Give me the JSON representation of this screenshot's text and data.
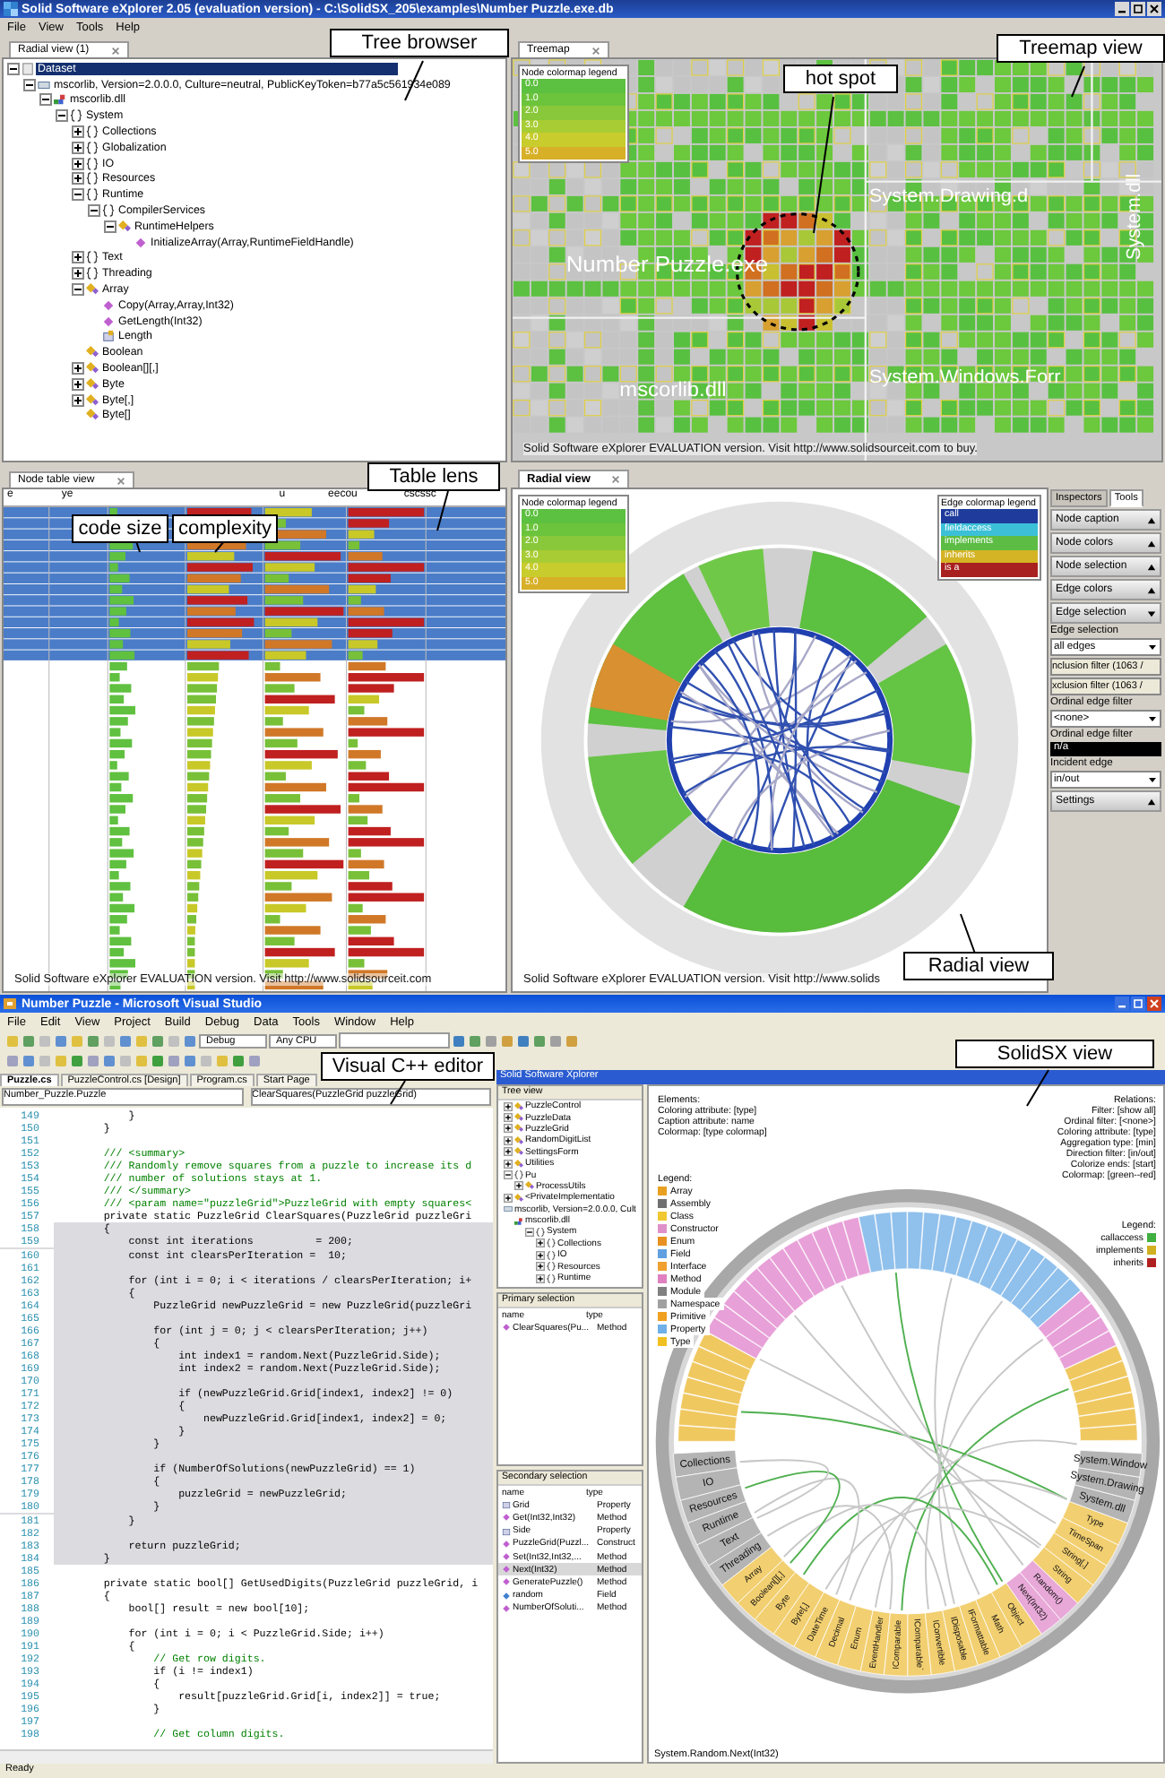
{
  "app_window": {
    "title": "Solid Software eXplorer 2.05 (evaluation version) - C:\\SolidSX_205\\examples\\Number Puzzle.exe.db",
    "menu": [
      "File",
      "View",
      "Tools",
      "Help"
    ]
  },
  "tree_browser": {
    "tab": "Radial view (1)",
    "items": [
      {
        "label": "Dataset",
        "kind": "dataset",
        "expanded": true,
        "selected": true,
        "children": [
          {
            "label": "mscorlib, Version=2.0.0.0, Culture=neutral, PublicKeyToken=b77a5c561934e089",
            "kind": "assembly",
            "expanded": true,
            "selected": false,
            "children": [
              {
                "label": "mscorlib.dll",
                "kind": "module",
                "expanded": true,
                "selected": false,
                "children": [
                  {
                    "label": "System",
                    "kind": "namespace",
                    "expanded": true,
                    "selected": false,
                    "children": [
                      {
                        "label": "Collections",
                        "kind": "namespace",
                        "expanded": false,
                        "selected": false
                      },
                      {
                        "label": "Globalization",
                        "kind": "namespace",
                        "expanded": false,
                        "selected": false
                      },
                      {
                        "label": "IO",
                        "kind": "namespace",
                        "expanded": false,
                        "selected": false
                      },
                      {
                        "label": "Resources",
                        "kind": "namespace",
                        "expanded": false,
                        "selected": false
                      },
                      {
                        "label": "Runtime",
                        "kind": "namespace",
                        "expanded": true,
                        "selected": false,
                        "children": [
                          {
                            "label": "CompilerServices",
                            "kind": "namespace",
                            "expanded": true,
                            "selected": false,
                            "children": [
                              {
                                "label": "RuntimeHelpers",
                                "kind": "class",
                                "expanded": true,
                                "selected": false,
                                "children": [
                                  {
                                    "label": "InitializeArray(Array,RuntimeFieldHandle)",
                                    "kind": "method",
                                    "selected": false
                                  }
                                ]
                              }
                            ]
                          }
                        ]
                      },
                      {
                        "label": "Text",
                        "kind": "namespace",
                        "expanded": false,
                        "selected": false
                      },
                      {
                        "label": "Threading",
                        "kind": "namespace",
                        "expanded": false,
                        "selected": false
                      },
                      {
                        "label": "Array",
                        "kind": "class",
                        "expanded": true,
                        "selected": false,
                        "children": [
                          {
                            "label": "Copy(Array,Array,Int32)",
                            "kind": "method",
                            "selected": false
                          },
                          {
                            "label": "GetLength(Int32)",
                            "kind": "method",
                            "selected": false
                          },
                          {
                            "label": "Length",
                            "kind": "property",
                            "selected": false
                          }
                        ]
                      },
                      {
                        "label": "Boolean",
                        "kind": "class",
                        "selected": false
                      },
                      {
                        "label": "Boolean[][,]",
                        "kind": "class",
                        "expanded": false,
                        "selected": false
                      },
                      {
                        "label": "Byte",
                        "kind": "class",
                        "expanded": false,
                        "selected": false
                      },
                      {
                        "label": "Byte[,]",
                        "kind": "class",
                        "expanded": false,
                        "selected": false
                      },
                      {
                        "label": "Byte[]",
                        "kind": "class",
                        "selected": false
                      }
                    ]
                  }
                ]
              }
            ]
          }
        ]
      }
    ]
  },
  "treemap": {
    "tab": "Treemap",
    "legend_title": "Node colormap legend",
    "legend": [
      {
        "label": "0.0",
        "color": "#5cc040"
      },
      {
        "label": "1.0",
        "color": "#6cc43c"
      },
      {
        "label": "2.0",
        "color": "#88c83a"
      },
      {
        "label": "3.0",
        "color": "#a8cc34"
      },
      {
        "label": "4.0",
        "color": "#c8cc2c"
      },
      {
        "label": "5.0",
        "color": "#d8b028"
      }
    ],
    "regions": [
      "Number Puzzle.exe",
      "System.Drawing.d",
      "System.dll",
      "System.Windows.Forr",
      "mscorlib.dll"
    ],
    "notice": "Solid Software eXplorer EVALUATION version. Visit http://www.solidsourceit.com to buy."
  },
  "table_view": {
    "tab": "Node table view",
    "headers": [
      "e",
      "ye",
      "u",
      "eecou",
      "cscssc"
    ],
    "notice": "Solid Software eXplorer EVALUATION version. Visit http://www.solidsourceit.com"
  },
  "radial_view": {
    "tab": "Radial view",
    "node_legend_title": "Node colormap legend",
    "node_legend": [
      {
        "label": "0.0",
        "color": "#5cc040"
      },
      {
        "label": "1.0",
        "color": "#6cc43c"
      },
      {
        "label": "2.0",
        "color": "#88c83a"
      },
      {
        "label": "3.0",
        "color": "#a8cc34"
      },
      {
        "label": "4.0",
        "color": "#c8cc2c"
      },
      {
        "label": "5.0",
        "color": "#d8b028"
      }
    ],
    "edge_legend_title": "Edge colormap legend",
    "edge_legend": [
      {
        "label": "call",
        "color": "#1f3c9c"
      },
      {
        "label": "fieldaccess",
        "color": "#3cc0d8"
      },
      {
        "label": "implements",
        "color": "#5cbc44"
      },
      {
        "label": "inherits",
        "color": "#d4b424"
      },
      {
        "label": "is a",
        "color": "#a82020"
      }
    ],
    "notice": "Solid Software eXplorer EVALUATION version. Visit http://www.solids"
  },
  "tools_panel": {
    "tabs": [
      {
        "label": "Inspectors",
        "selected": false
      },
      {
        "label": "Tools",
        "selected": true
      }
    ],
    "controls": [
      {
        "kind": "section",
        "label": "Node caption",
        "expanded": false
      },
      {
        "kind": "section",
        "label": "Node colors",
        "expanded": false
      },
      {
        "kind": "section",
        "label": "Node selection",
        "expanded": false
      },
      {
        "kind": "section",
        "label": "Edge colors",
        "expanded": false
      },
      {
        "kind": "section",
        "label": "Edge selection",
        "expanded": true
      },
      {
        "kind": "label",
        "label": "Edge selection"
      },
      {
        "kind": "dropdown",
        "label": "all edges"
      },
      {
        "kind": "button",
        "label": "nclusion filter (1063 /"
      },
      {
        "kind": "button",
        "label": "xclusion filter (1063 /"
      },
      {
        "kind": "label",
        "label": "Ordinal edge filter"
      },
      {
        "kind": "dropdown",
        "label": "<none>"
      },
      {
        "kind": "label",
        "label": "Ordinal edge filter"
      },
      {
        "kind": "dark_field",
        "label": "n/a"
      },
      {
        "kind": "label",
        "label": "Incident edge"
      },
      {
        "kind": "dropdown",
        "label": "in/out"
      },
      {
        "kind": "section",
        "label": "Settings",
        "expanded": false
      }
    ]
  },
  "vs_window": {
    "title": "Number Puzzle - Microsoft Visual Studio",
    "menu": [
      "File",
      "Edit",
      "View",
      "Project",
      "Build",
      "Debug",
      "Data",
      "Tools",
      "Window",
      "Help"
    ],
    "toolbar_fields": [
      "Debug",
      "Any CPU"
    ],
    "tabs": [
      {
        "label": "Puzzle.cs",
        "selected": true
      },
      {
        "label": "PuzzleControl.cs [Design]",
        "selected": false
      },
      {
        "label": "Program.cs",
        "selected": false
      },
      {
        "label": "Start Page",
        "selected": false
      }
    ],
    "class_dropdown": "Number_Puzzle.Puzzle",
    "member_dropdown": "ClearSquares(PuzzleGrid puzzleGrid)",
    "code_lines": [
      {
        "number": "149",
        "text": "            }",
        "kind": "code",
        "highlighted": false
      },
      {
        "number": "150",
        "text": "        }",
        "kind": "code",
        "highlighted": false
      },
      {
        "number": "151",
        "highlighted": false
      },
      {
        "number": "152",
        "text": "        /// <summary>",
        "kind": "comment",
        "highlighted": false
      },
      {
        "number": "153",
        "text": "        /// Randomly remove squares from a puzzle to increase its d",
        "kind": "comment",
        "highlighted": false
      },
      {
        "number": "154",
        "text": "        /// number of solutions stays at 1.",
        "kind": "comment",
        "highlighted": false
      },
      {
        "number": "155",
        "text": "        /// </summary>",
        "kind": "comment",
        "highlighted": false
      },
      {
        "number": "156",
        "text": "        /// <param name=\"puzzleGrid\">PuzzleGrid with empty squares<",
        "kind": "comment",
        "highlighted": false
      },
      {
        "number": "157",
        "text": "        private static PuzzleGrid ClearSquares(PuzzleGrid puzzleGri",
        "kind": "code",
        "highlighted": false
      },
      {
        "number": "158",
        "text": "        {",
        "kind": "code",
        "highlighted": true
      },
      {
        "number": "159",
        "text": "            const int iterations          = 200;",
        "kind": "code",
        "highlighted": true
      },
      {
        "number": "160",
        "text": "            const int clearsPerIteration =  10;",
        "kind": "code",
        "highlighted": true
      },
      {
        "number": "161",
        "highlighted": true
      },
      {
        "number": "162",
        "text": "            for (int i = 0; i < iterations / clearsPerIteration; i+",
        "kind": "code",
        "highlighted": true
      },
      {
        "number": "163",
        "text": "            {",
        "kind": "code",
        "highlighted": true
      },
      {
        "number": "164",
        "text": "                PuzzleGrid newPuzzleGrid = new PuzzleGrid(puzzleGri",
        "kind": "code",
        "highlighted": true
      },
      {
        "number": "165",
        "highlighted": true
      },
      {
        "number": "166",
        "text": "                for (int j = 0; j < clearsPerIteration; j++)",
        "kind": "code",
        "highlighted": true
      },
      {
        "number": "167",
        "text": "                {",
        "kind": "code",
        "highlighted": true
      },
      {
        "number": "168",
        "text": "                    int index1 = random.Next(PuzzleGrid.Side);",
        "kind": "code",
        "highlighted": true
      },
      {
        "number": "169",
        "text": "                    int index2 = random.Next(PuzzleGrid.Side);",
        "kind": "code",
        "highlighted": true
      },
      {
        "number": "170",
        "highlighted": true
      },
      {
        "number": "171",
        "text": "                    if (newPuzzleGrid.Grid[index1, index2] != 0)",
        "kind": "code",
        "highlighted": true
      },
      {
        "number": "172",
        "text": "                    {",
        "kind": "code",
        "highlighted": true
      },
      {
        "number": "173",
        "text": "                        newPuzzleGrid.Grid[index1, index2] = 0;",
        "kind": "code",
        "highlighted": true
      },
      {
        "number": "174",
        "text": "                    }",
        "kind": "code",
        "highlighted": true
      },
      {
        "number": "175",
        "text": "                }",
        "kind": "code",
        "highlighted": true
      },
      {
        "number": "176",
        "highlighted": true
      },
      {
        "number": "177",
        "text": "                if (NumberOfSolutions(newPuzzleGrid) == 1)",
        "kind": "code",
        "highlighted": true
      },
      {
        "number": "178",
        "text": "                {",
        "kind": "code",
        "highlighted": true
      },
      {
        "number": "179",
        "text": "                    puzzleGrid = newPuzzleGrid;",
        "kind": "code",
        "highlighted": true
      },
      {
        "number": "180",
        "text": "                }",
        "kind": "code",
        "highlighted": true
      },
      {
        "number": "181",
        "text": "            }",
        "kind": "code",
        "highlighted": true
      },
      {
        "number": "182",
        "highlighted": true
      },
      {
        "number": "183",
        "text": "            return puzzleGrid;",
        "kind": "code",
        "highlighted": true
      },
      {
        "number": "184",
        "text": "        }",
        "kind": "code",
        "highlighted": true
      },
      {
        "number": "185",
        "highlighted": false
      },
      {
        "number": "186",
        "text": "        private static bool[] GetUsedDigits(PuzzleGrid puzzleGrid, i",
        "kind": "code",
        "highlighted": false
      },
      {
        "number": "187",
        "text": "        {",
        "kind": "code",
        "highlighted": false
      },
      {
        "number": "188",
        "text": "            bool[] result = new bool[10];",
        "kind": "code",
        "highlighted": false
      },
      {
        "number": "189",
        "highlighted": false
      },
      {
        "number": "190",
        "text": "            for (int i = 0; i < PuzzleGrid.Side; i++)",
        "kind": "code",
        "highlighted": false
      },
      {
        "number": "191",
        "text": "            {",
        "kind": "code",
        "highlighted": false
      },
      {
        "number": "192",
        "text": "                // Get row digits.",
        "kind": "comment",
        "highlighted": false
      },
      {
        "number": "193",
        "text": "                if (i != index1)",
        "kind": "code",
        "highlighted": false
      },
      {
        "number": "194",
        "text": "                {",
        "kind": "code",
        "highlighted": false
      },
      {
        "number": "195",
        "text": "                    result[puzzleGrid.Grid[i, index2]] = true;",
        "kind": "code",
        "highlighted": false
      },
      {
        "number": "196",
        "text": "                }",
        "kind": "code",
        "highlighted": false
      },
      {
        "number": "197",
        "highlighted": false
      },
      {
        "number": "198",
        "text": "                // Get column digits.",
        "kind": "comment",
        "highlighted": false
      }
    ],
    "status": "Ready"
  },
  "sx_panel": {
    "title": "Solid Software Xplorer",
    "tree_title": "Tree view",
    "tree_items": [
      {
        "label": "PuzzleControl",
        "kind": "class",
        "expanded": false
      },
      {
        "label": "PuzzleData",
        "kind": "class",
        "expanded": false
      },
      {
        "label": "PuzzleGrid",
        "kind": "class",
        "expanded": false
      },
      {
        "label": "RandomDigitList",
        "kind": "class",
        "expanded": false
      },
      {
        "label": "SettingsForm",
        "kind": "class",
        "expanded": false
      },
      {
        "label": "Utilities",
        "kind": "class",
        "expanded": false
      },
      {
        "label": "Pu",
        "kind": "namespace",
        "expanded": true,
        "children": [
          {
            "label": "ProcessUtils",
            "kind": "class",
            "expanded": false
          }
        ]
      },
      {
        "label": "<PrivateImplementatio",
        "kind": "class",
        "expanded": false
      },
      {
        "label": "mscorlib, Version=2.0.0.0, Cult",
        "kind": "assembly",
        "children": [
          {
            "label": "mscorlib.dll",
            "kind": "module",
            "children": [
              {
                "label": "System",
                "kind": "namespace",
                "expanded": true,
                "children": [
                  {
                    "label": "Collections",
                    "kind": "namespace",
                    "expanded": false
                  },
                  {
                    "label": "IO",
                    "kind": "namespace",
                    "expanded": false
                  },
                  {
                    "label": "Resources",
                    "kind": "namespace",
                    "expanded": false
                  },
                  {
                    "label": "Runtime",
                    "kind": "namespace",
                    "expanded": false
                  }
                ]
              }
            ]
          }
        ]
      }
    ],
    "primary_title": "Primary selection",
    "columns": [
      "name",
      "type"
    ],
    "primary_rows": [
      {
        "name": "ClearSquares(Pu...",
        "type": "Method",
        "kind": "method"
      }
    ],
    "secondary_title": "Secondary selection",
    "secondary_columns": [
      "name",
      "type"
    ],
    "secondary_rows": [
      {
        "name": "Grid",
        "type": "Property",
        "kind": "property",
        "selected": false
      },
      {
        "name": "Get(Int32,Int32)",
        "type": "Method",
        "kind": "method",
        "selected": false
      },
      {
        "name": "Side",
        "type": "Property",
        "kind": "property",
        "selected": false
      },
      {
        "name": "PuzzleGrid(Puzzl...",
        "type": "Construct",
        "kind": "method",
        "selected": false
      },
      {
        "name": "Set(Int32,Int32,...",
        "type": "Method",
        "kind": "method",
        "selected": false
      },
      {
        "name": "Next(Int32)",
        "type": "Method",
        "kind": "method",
        "selected": true
      },
      {
        "name": "GeneratePuzzle()",
        "type": "Method",
        "kind": "method",
        "selected": false
      },
      {
        "name": "random",
        "type": "Field",
        "kind": "field",
        "selected": false
      },
      {
        "name": "NumberOfSoluti...",
        "type": "Method",
        "kind": "method",
        "selected": false
      }
    ]
  },
  "solidsx_view": {
    "elements_title": "Elements:",
    "elements": [
      "Coloring attribute: [type]",
      "Caption attribute: name",
      "Colormap: [type colormap]"
    ],
    "relations_title": "Relations:",
    "relations": [
      "Filter: [show all]",
      "Ordinal filter: [<none>]",
      "Coloring attribute: [type]",
      "Aggregation type: [min]",
      "Direction filter: [in/out]",
      "Colorize ends: [start]",
      "Colormap: [green--red]"
    ],
    "legend_title": "Legend:",
    "legend": [
      {
        "label": "Array",
        "color": "#e8a020"
      },
      {
        "label": "Assembly",
        "color": "#707070"
      },
      {
        "label": "Class",
        "color": "#f0c830"
      },
      {
        "label": "Constructor",
        "color": "#e090c8"
      },
      {
        "label": "Enum",
        "color": "#e89020"
      },
      {
        "label": "Field",
        "color": "#60a0e0"
      },
      {
        "label": "Interface",
        "color": "#f0a030"
      },
      {
        "label": "Method",
        "color": "#e080c0"
      },
      {
        "label": "Module",
        "color": "#808080"
      },
      {
        "label": "Namespace",
        "color": "#a0a0a0"
      },
      {
        "label": "Primitive",
        "color": "#f0a020"
      },
      {
        "label": "Property",
        "color": "#70b0e8"
      },
      {
        "label": "Type",
        "color": "#f0c020"
      }
    ],
    "relation_legend_title": "Legend:",
    "relation_legend": [
      {
        "label": "callaccess",
        "color": "#40b040"
      },
      {
        "label": "implements",
        "color": "#d0b020"
      },
      {
        "label": "inherits",
        "color": "#b02020"
      }
    ],
    "ring_labels": [
      {
        "label": "Collections",
        "kind": "namespace"
      },
      {
        "label": "IO",
        "kind": "namespace"
      },
      {
        "label": "Resources",
        "kind": "namespace"
      },
      {
        "label": "Runtime",
        "kind": "namespace"
      },
      {
        "label": "Text",
        "kind": "namespace"
      },
      {
        "label": "Threading",
        "kind": "namespace"
      },
      {
        "label": "Array",
        "kind": "type"
      },
      {
        "label": "Boolean[][,]",
        "kind": "type"
      },
      {
        "label": "Byte",
        "kind": "type"
      },
      {
        "label": "Byte[,]",
        "kind": "type"
      },
      {
        "label": "DateTime",
        "kind": "type"
      },
      {
        "label": "Decimal",
        "kind": "type"
      },
      {
        "label": "Enum",
        "kind": "type"
      },
      {
        "label": "EventHandler",
        "kind": "type"
      },
      {
        "label": "IComparable",
        "kind": "type"
      },
      {
        "label": "IComparable`",
        "kind": "type"
      },
      {
        "label": "IConvertible",
        "kind": "type"
      },
      {
        "label": "IDisposable",
        "kind": "type"
      },
      {
        "label": "IFormattable",
        "kind": "type"
      },
      {
        "label": "Math",
        "kind": "type"
      },
      {
        "label": "Object",
        "kind": "type"
      },
      {
        "label": "Next(Int32)",
        "kind": "method"
      },
      {
        "label": "Random()",
        "kind": "method"
      },
      {
        "label": "String",
        "kind": "type"
      },
      {
        "label": "String[,]",
        "kind": "type"
      },
      {
        "label": "TimeSpan",
        "kind": "type"
      },
      {
        "label": "Type",
        "kind": "type"
      },
      {
        "label": "System.dll",
        "kind": "namespace"
      },
      {
        "label": "System.Drawing",
        "kind": "namespace"
      },
      {
        "label": "System.Window",
        "kind": "namespace"
      }
    ],
    "status": "System.Random.Next(Int32)"
  },
  "callouts": [
    {
      "text": "Tree browser"
    },
    {
      "text": "Treemap view"
    },
    {
      "text": "hot spot"
    },
    {
      "text": "code size"
    },
    {
      "text": "complexity"
    },
    {
      "text": "Table lens"
    },
    {
      "text": "Radial view"
    },
    {
      "text": "Visual C++ editor"
    },
    {
      "text": "SolidSX view"
    }
  ]
}
